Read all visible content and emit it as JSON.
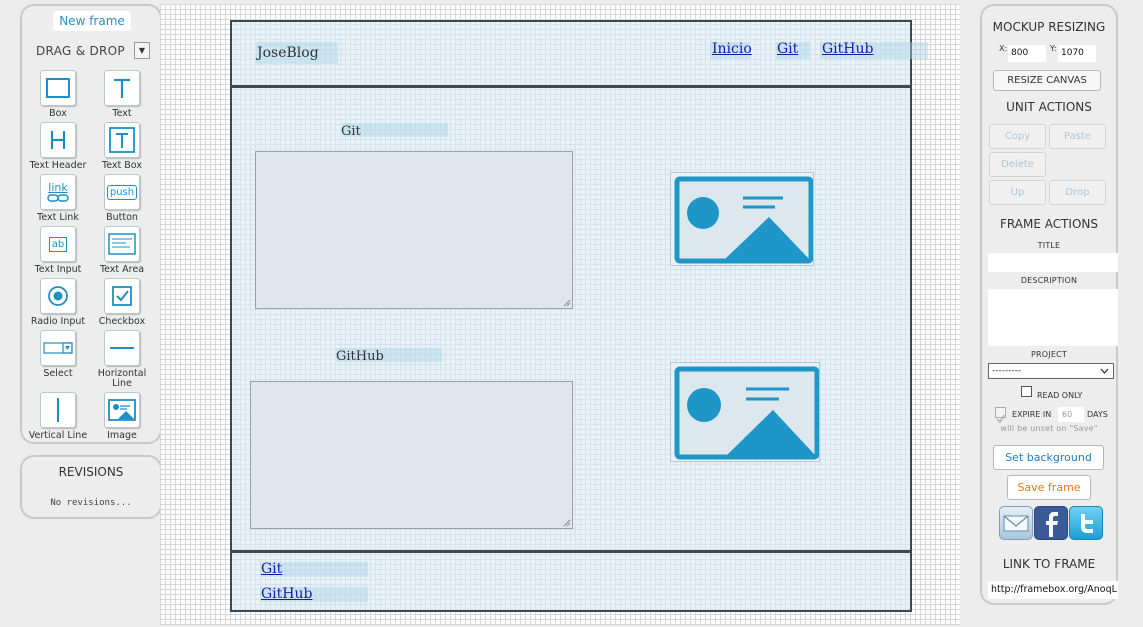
{
  "left_panel": {
    "new_frame_label": "New frame",
    "drag_drop_label": "DRAG & DROP",
    "tools": [
      {
        "label": "Box",
        "icon": "box-icon"
      },
      {
        "label": "Text",
        "icon": "text-icon"
      },
      {
        "label": "Text Header",
        "icon": "text-header-icon"
      },
      {
        "label": "Text Box",
        "icon": "text-box-icon"
      },
      {
        "label": "Text Link",
        "icon": "text-link-icon",
        "icon_text": "link"
      },
      {
        "label": "Button",
        "icon": "button-icon",
        "icon_text": "push"
      },
      {
        "label": "Text Input",
        "icon": "text-input-icon",
        "icon_text": "ab"
      },
      {
        "label": "Text Area",
        "icon": "text-area-icon"
      },
      {
        "label": "Radio Input",
        "icon": "radio-icon"
      },
      {
        "label": "Checkbox",
        "icon": "checkbox-icon"
      },
      {
        "label": "Select",
        "icon": "select-icon"
      },
      {
        "label": "Horizontal Line",
        "icon": "horizontal-line-icon"
      },
      {
        "label": "Vertical Line",
        "icon": "vertical-line-icon"
      },
      {
        "label": "Image",
        "icon": "image-icon"
      }
    ]
  },
  "revisions": {
    "title": "REVISIONS",
    "empty_text": "No revisions..."
  },
  "mockup": {
    "header": {
      "brand": "JoseBlog",
      "nav": [
        "Inicio",
        "Git",
        "GitHub"
      ]
    },
    "sections": [
      {
        "heading": "Git"
      },
      {
        "heading": "GitHub"
      }
    ],
    "footer_links": [
      "Git",
      "GitHub"
    ]
  },
  "right_panel": {
    "mockup_resizing_title": "MOCKUP RESIZING",
    "x_label": "X:",
    "x_value": "800",
    "y_label": "Y:",
    "y_value": "1070",
    "resize_button": "RESIZE CANVAS",
    "unit_actions_title": "UNIT ACTIONS",
    "unit_buttons": [
      "Copy",
      "Paste",
      "Delete",
      "Up",
      "Drop"
    ],
    "frame_actions_title": "FRAME ACTIONS",
    "title_label": "TITLE",
    "title_value": "",
    "description_label": "DESCRIPTION",
    "description_value": "",
    "project_label": "PROJECT",
    "project_value": "---------",
    "read_only_label": "READ ONLY",
    "read_only_checked": false,
    "expire_in_label": "EXPIRE IN",
    "expire_days_value": "60",
    "days_label": "DAYS",
    "expire_note": "will be unset on \"Save\"",
    "set_background_button": "Set background",
    "save_frame_button": "Save frame",
    "link_to_frame_title": "LINK TO FRAME",
    "link_value": "http://framebox.org/AnoqL",
    "colors": {
      "accent_blue": "#2a8fc6",
      "save_orange": "#e07a10",
      "image_blue": "#1e96c8"
    }
  }
}
